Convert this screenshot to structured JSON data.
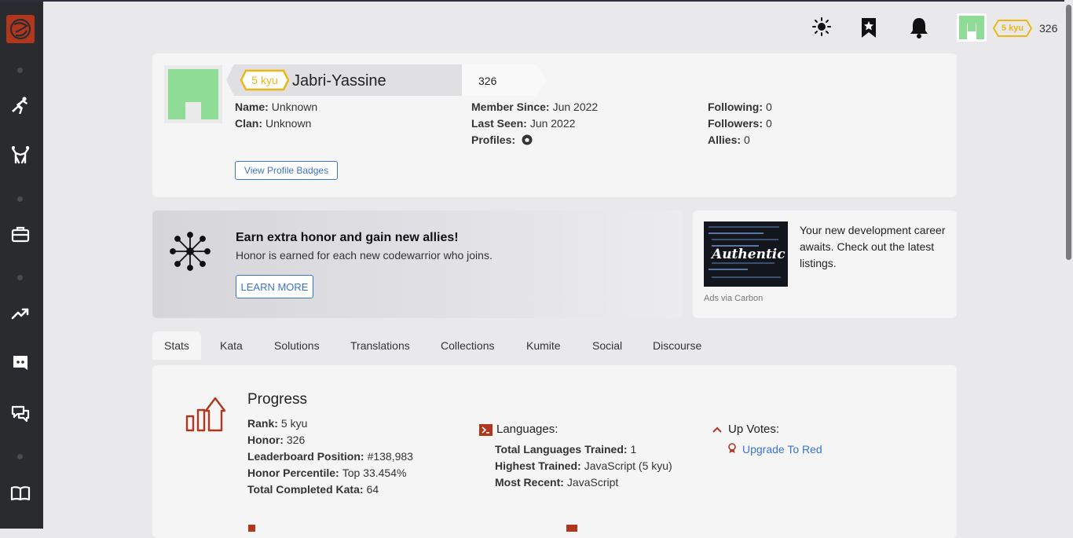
{
  "header": {
    "theme_icon": "sun-icon",
    "bookmark_icon": "bookmark-star-icon",
    "bell_icon": "bell-icon",
    "rank": "5 kyu",
    "honor": "326"
  },
  "sidebar": {
    "logo": "codewars-logo",
    "items": [
      {
        "icon": "training-icon"
      },
      {
        "icon": "practice-icon"
      },
      {
        "icon": "jobs-icon"
      },
      {
        "icon": "leaderboard-icon"
      },
      {
        "icon": "discord-icon"
      },
      {
        "icon": "chat-icon"
      },
      {
        "icon": "docs-icon"
      }
    ]
  },
  "profile": {
    "rank": "5 kyu",
    "username": "Jabri-Yassine",
    "honor": "326",
    "col1": [
      {
        "label": "Name:",
        "value": "Unknown"
      },
      {
        "label": "Clan:",
        "value": "Unknown"
      }
    ],
    "col2": [
      {
        "label": "Member Since:",
        "value": "Jun 2022"
      },
      {
        "label": "Last Seen:",
        "value": "Jun 2022"
      },
      {
        "label": "Profiles:",
        "value": ""
      }
    ],
    "col3": [
      {
        "label": "Following:",
        "value": "0"
      },
      {
        "label": "Followers:",
        "value": "0"
      },
      {
        "label": "Allies:",
        "value": "0"
      }
    ],
    "badges_button": "View Profile Badges"
  },
  "promo": {
    "title": "Earn extra honor and gain new allies!",
    "subtitle": "Honor is earned for each new codewarrior who joins.",
    "button": "LEARN MORE"
  },
  "ad": {
    "text": "Your new development career awaits. Check out the latest listings.",
    "image_word": "Authentic",
    "credit": "Ads via Carbon"
  },
  "tabs": [
    "Stats",
    "Kata",
    "Solutions",
    "Translations",
    "Collections",
    "Kumite",
    "Social",
    "Discourse"
  ],
  "stats": {
    "progress_title": "Progress",
    "progress": [
      {
        "label": "Rank:",
        "value": "5 kyu"
      },
      {
        "label": "Honor:",
        "value": "326"
      },
      {
        "label": "Leaderboard Position:",
        "value": "#138,983"
      },
      {
        "label": "Honor Percentile:",
        "value": "Top 33.454%"
      },
      {
        "label": "Total Completed Kata:",
        "value": "64"
      }
    ],
    "languages_title": "Languages:",
    "languages": [
      {
        "label": "Total Languages Trained:",
        "value": "1"
      },
      {
        "label": "Highest Trained:",
        "value": "JavaScript (5 kyu)"
      },
      {
        "label": "Most Recent:",
        "value": "JavaScript"
      }
    ],
    "upvotes_title": "Up Votes:",
    "upgrade_link": "Upgrade To Red"
  },
  "colors": {
    "accent_red": "#b1361e",
    "link_blue": "#3a74c9",
    "rank_yellow": "#ecb613",
    "avatar_green": "#8fdc97"
  }
}
